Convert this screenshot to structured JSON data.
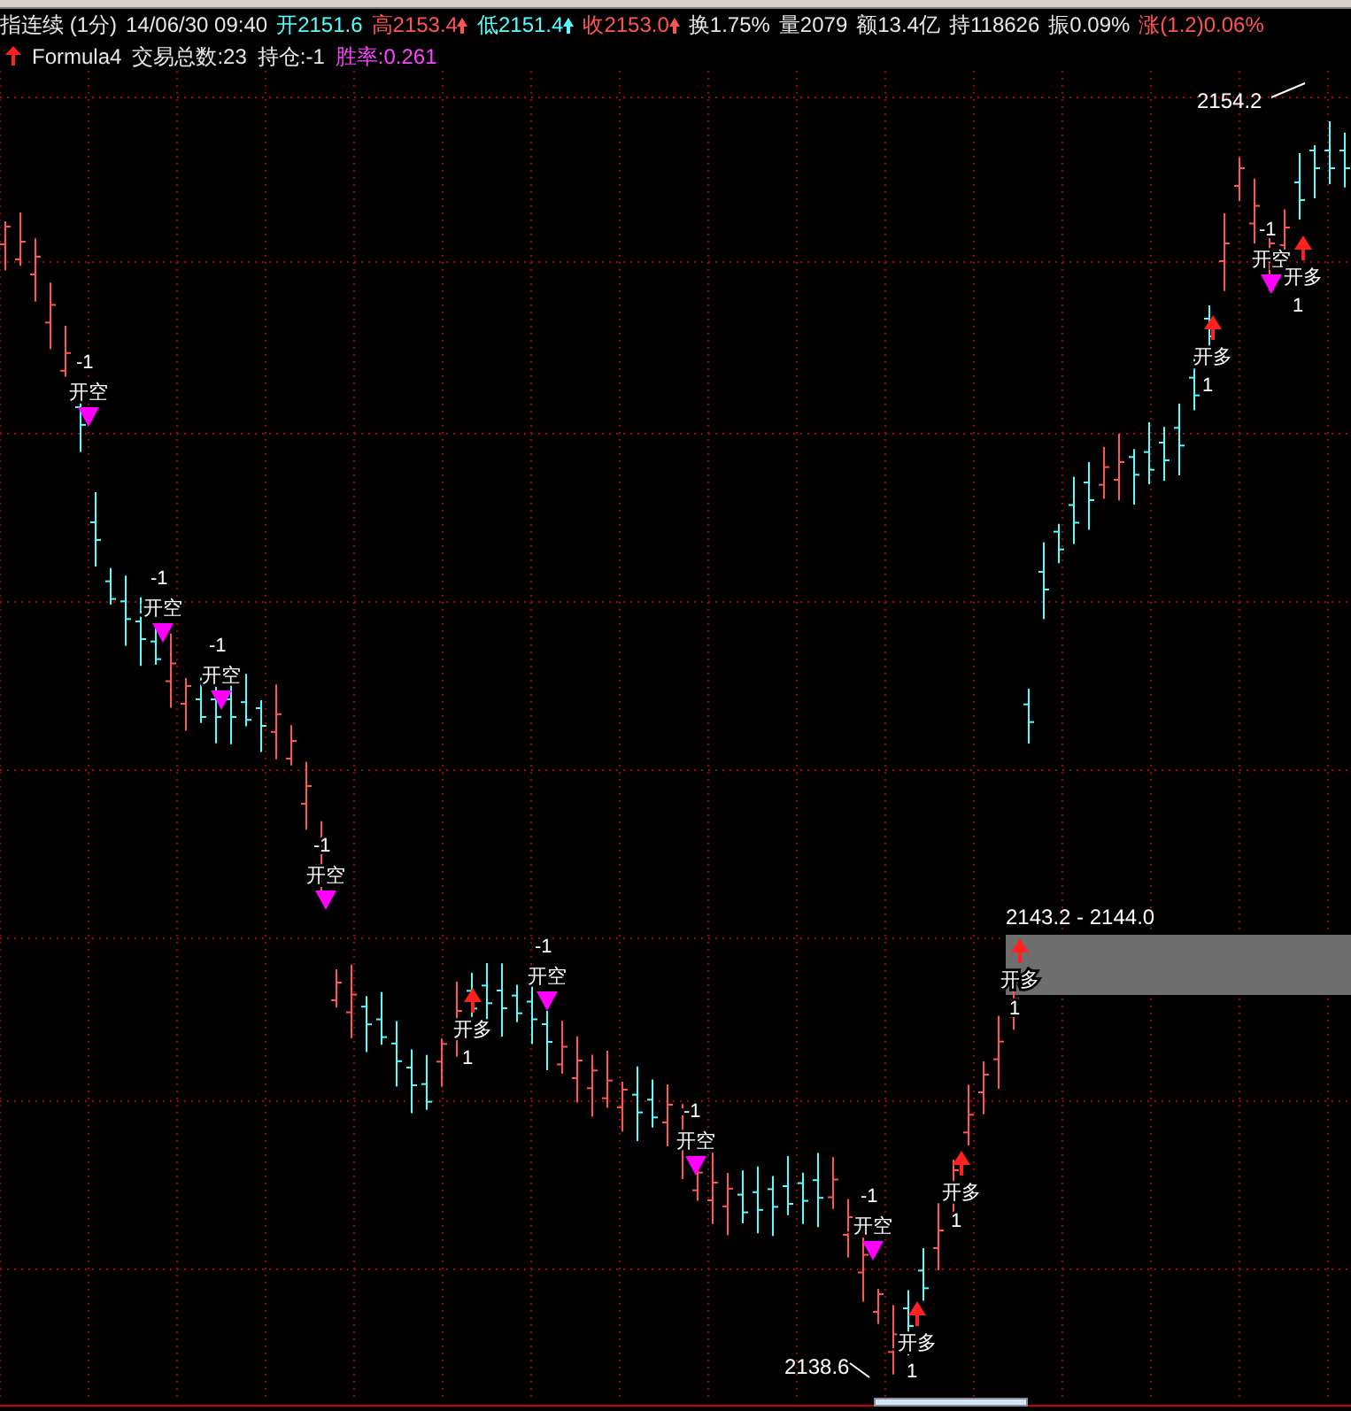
{
  "quote_bar": [
    {
      "text": "指连续 (1分)",
      "kind": "plain",
      "marker": false
    },
    {
      "text": "14/06/30 09:40",
      "kind": "plain",
      "marker": false
    },
    {
      "text": "开2151.6",
      "kind": "down",
      "marker": false
    },
    {
      "text": "高2153.4",
      "kind": "up",
      "marker": true
    },
    {
      "text": "低2151.4",
      "kind": "down",
      "marker": true
    },
    {
      "text": "收2153.0",
      "kind": "up",
      "marker": true
    },
    {
      "text": "换1.75%",
      "kind": "plain",
      "marker": false
    },
    {
      "text": "量2079",
      "kind": "plain",
      "marker": false
    },
    {
      "text": "额13.4亿",
      "kind": "plain",
      "marker": false
    },
    {
      "text": "持118626",
      "kind": "plain",
      "marker": false
    },
    {
      "text": "振0.09%",
      "kind": "plain",
      "marker": false
    },
    {
      "text": "涨(1.2)0.06%",
      "kind": "up",
      "marker": false
    }
  ],
  "formula_bar": {
    "name": "Formula4",
    "stats": [
      {
        "text": "交易总数:23",
        "kind": "plain"
      },
      {
        "text": "持仓:-1",
        "kind": "plain"
      },
      {
        "text": "胜率:0.261",
        "kind": "accent"
      }
    ]
  },
  "chart": {
    "high_label": "2154.2",
    "low_label": "2138.6",
    "range_label": "2143.2 - 2144.0",
    "signals": [
      {
        "kind": "short",
        "label": "开空",
        "qty": "-1"
      },
      {
        "kind": "short",
        "label": "开空",
        "qty": "-1"
      },
      {
        "kind": "short",
        "label": "开空",
        "qty": "-1"
      },
      {
        "kind": "short",
        "label": "开空",
        "qty": "-1"
      },
      {
        "kind": "long",
        "label": "开多",
        "qty": "1"
      },
      {
        "kind": "short",
        "label": "开空",
        "qty": "-1"
      },
      {
        "kind": "short",
        "label": "开空",
        "qty": "-1"
      },
      {
        "kind": "short",
        "label": "开空",
        "qty": "-1"
      },
      {
        "kind": "long",
        "label": "开多",
        "qty": "1"
      },
      {
        "kind": "long",
        "label": "开多",
        "qty": "1"
      },
      {
        "kind": "long",
        "label": "开多",
        "qty": "1"
      },
      {
        "kind": "long",
        "label": "开多",
        "qty": "1"
      },
      {
        "kind": "short",
        "label": "开空",
        "qty": "-1"
      },
      {
        "kind": "long",
        "label": "开多",
        "qty": "1"
      }
    ]
  }
}
